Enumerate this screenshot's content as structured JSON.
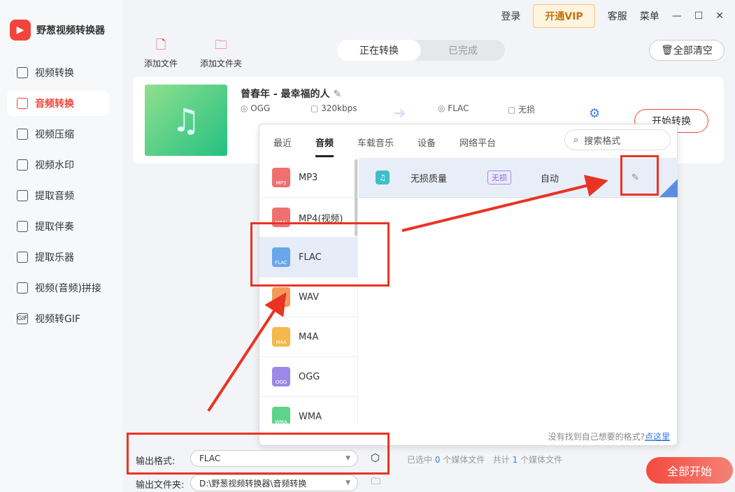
{
  "app": {
    "name": "野葱视频转换器"
  },
  "topbar": {
    "login": "登录",
    "vip": "开通VIP",
    "service": "客服",
    "menu": "菜单"
  },
  "sidebar": {
    "items": [
      {
        "label": "视频转换"
      },
      {
        "label": "音频转换"
      },
      {
        "label": "视频压缩"
      },
      {
        "label": "视频水印"
      },
      {
        "label": "提取音频"
      },
      {
        "label": "提取伴奏"
      },
      {
        "label": "提取乐器"
      },
      {
        "label": "视频(音频)拼接"
      },
      {
        "label": "视频转GIF"
      }
    ]
  },
  "toolbar": {
    "add_file": "添加文件",
    "add_folder": "添加文件夹",
    "tab_converting": "正在转换",
    "tab_done": "已完成",
    "clear_all": "全部清空"
  },
  "file": {
    "title": "曾春年 - 最幸福的人",
    "src_format": "OGG",
    "src_bitrate": "320kbps",
    "dst_format": "FLAC",
    "dst_quality": "无损",
    "start": "开始转换"
  },
  "popup": {
    "tabs": [
      "最近",
      "音频",
      "车载音乐",
      "设备",
      "网络平台"
    ],
    "search_placeholder": "搜索格式",
    "formats": [
      {
        "name": "MP3",
        "color": "#f07070"
      },
      {
        "name": "MP4(视频)",
        "color": "#f07070"
      },
      {
        "name": "FLAC",
        "color": "#6aa6ea"
      },
      {
        "name": "WAV",
        "color": "#f39a5a"
      },
      {
        "name": "M4A",
        "color": "#f5b84a"
      },
      {
        "name": "OGG",
        "color": "#9b88e8"
      },
      {
        "name": "WMA",
        "color": "#5ed48a"
      }
    ],
    "quality": {
      "name": "无损质量",
      "badge": "无损",
      "value": "自动"
    },
    "hint": "没有找到自己想要的格式?",
    "hint_link": "点这里"
  },
  "bottom": {
    "format_label": "输出格式:",
    "format_value": "FLAC",
    "folder_label": "输出文件夹:",
    "folder_value": "D:\\野葱视频转换器\\音频转换",
    "selected_pre": "已选中",
    "selected_count": "0",
    "selected_post": "个媒体文件",
    "total_pre": "共计",
    "total_count": "1",
    "total_post": "个媒体文件",
    "start_all": "全部开始"
  }
}
